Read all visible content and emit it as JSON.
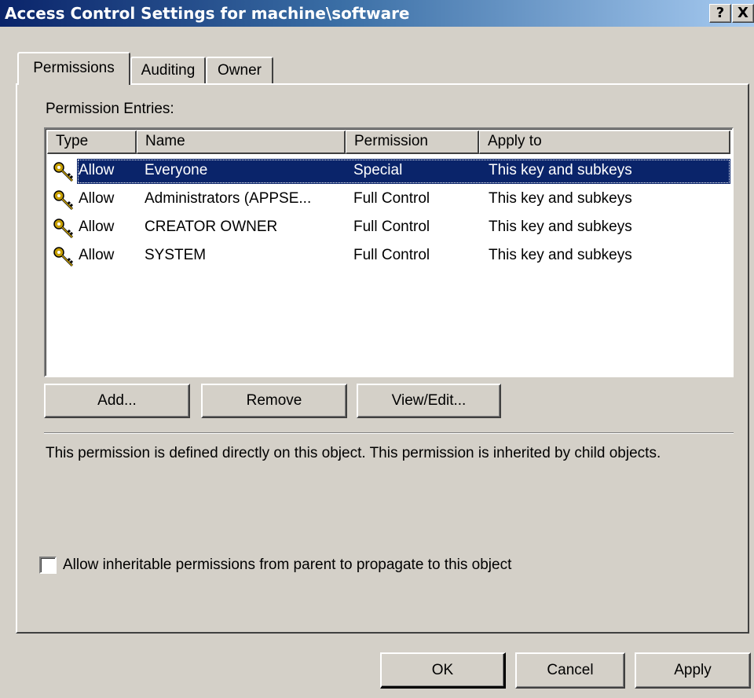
{
  "window": {
    "title": "Access Control Settings for machine\\software",
    "help_label": "?",
    "close_label": "X"
  },
  "tabs": [
    {
      "label": "Permissions",
      "active": true
    },
    {
      "label": "Auditing",
      "active": false
    },
    {
      "label": "Owner",
      "active": false
    }
  ],
  "entries_label": "Permission Entries:",
  "columns": [
    "Type",
    "Name",
    "Permission",
    "Apply to"
  ],
  "rows": [
    {
      "type": "Allow",
      "name": "Everyone",
      "permission": "Special",
      "apply_to": "This key and subkeys",
      "selected": true
    },
    {
      "type": "Allow",
      "name": "Administrators (APPSE...",
      "permission": "Full Control",
      "apply_to": "This key and subkeys",
      "selected": false
    },
    {
      "type": "Allow",
      "name": "CREATOR OWNER",
      "permission": "Full Control",
      "apply_to": "This key and subkeys",
      "selected": false
    },
    {
      "type": "Allow",
      "name": "SYSTEM",
      "permission": "Full Control",
      "apply_to": "This key and subkeys",
      "selected": false
    }
  ],
  "buttons": {
    "add": "Add...",
    "remove": "Remove",
    "view_edit": "View/Edit...",
    "ok": "OK",
    "cancel": "Cancel",
    "apply": "Apply"
  },
  "description": "This permission is defined directly on this object. This permission is inherited by child objects.",
  "inherit_checkbox": {
    "label": "Allow inheritable permissions from parent to propagate to this object",
    "checked": false
  },
  "colors": {
    "selection": "#0a246a",
    "face": "#d4d0c8"
  },
  "icons": {
    "entry_icon": "key-icon"
  }
}
